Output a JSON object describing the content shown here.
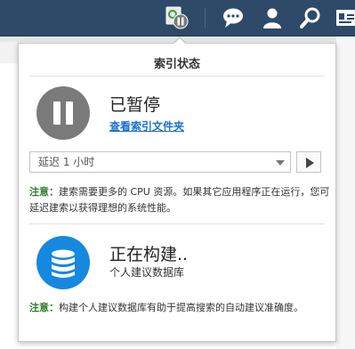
{
  "popup": {
    "title": "索引状态"
  },
  "index": {
    "status": "已暂停",
    "link": "查看索引文件夹",
    "delay_select": "延迟 1 小时",
    "note_label": "注意：",
    "note_text": "建索需要更多的 CPU 资源。如果其它应用程序正在运行，您可延迟建索以获得理想的系统性能。"
  },
  "database": {
    "status": "正在构建..",
    "subtitle": "个人建议数据库",
    "note_label": "注意：",
    "note_text": "构建个人建议数据库有助于提高搜索的自动建议准确度。"
  },
  "colors": {
    "topbar": "#2e4a68",
    "pause_icon": "#7a7a7a",
    "db_icon": "#1688e0",
    "link": "#1a73c9",
    "note_label": "#2f7b2f"
  },
  "icons": [
    "index-status-icon",
    "chat-icon",
    "user-icon",
    "search-icon",
    "id-card-icon",
    "pause-icon",
    "database-icon",
    "play-icon",
    "chevron-down-icon"
  ]
}
